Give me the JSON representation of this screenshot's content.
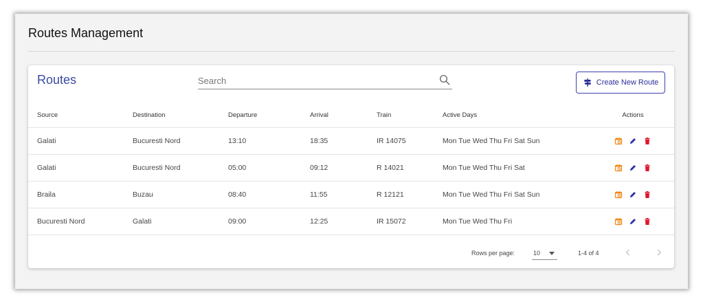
{
  "page": {
    "title": "Routes Management"
  },
  "card": {
    "title": "Routes",
    "search_placeholder": "Search",
    "create_label": "Create New Route"
  },
  "table": {
    "headers": {
      "source": "Source",
      "destination": "Destination",
      "departure": "Departure",
      "arrival": "Arrival",
      "train": "Train",
      "active_days": "Active Days",
      "actions": "Actions"
    },
    "rows": [
      {
        "source": "Galati",
        "destination": "Bucuresti Nord",
        "departure": "13:10",
        "arrival": "18:35",
        "train": "IR 14075",
        "active_days": "Mon Tue Wed Thu Fri Sat Sun"
      },
      {
        "source": "Galati",
        "destination": "Bucuresti Nord",
        "departure": "05:00",
        "arrival": "09:12",
        "train": "R 14021",
        "active_days": "Mon Tue Wed Thu Fri Sat"
      },
      {
        "source": "Braila",
        "destination": "Buzau",
        "departure": "08:40",
        "arrival": "11:55",
        "train": "R 12121",
        "active_days": "Mon Tue Wed Thu Fri Sat Sun"
      },
      {
        "source": "Bucuresti Nord",
        "destination": "Galati",
        "departure": "09:00",
        "arrival": "12:25",
        "train": "IR 15072",
        "active_days": "Mon Tue Wed Thu Fri"
      }
    ],
    "action_icons": [
      "schedule-icon",
      "edit-icon",
      "delete-icon"
    ]
  },
  "pagination": {
    "rows_per_page_label": "Rows per page:",
    "rows_per_page_value": "10",
    "range_label": "1-4 of 4"
  },
  "colors": {
    "accent": "#3b4aa3",
    "schedule": "#f08a1c",
    "edit": "#2a2fa8",
    "delete": "#e0162b"
  }
}
